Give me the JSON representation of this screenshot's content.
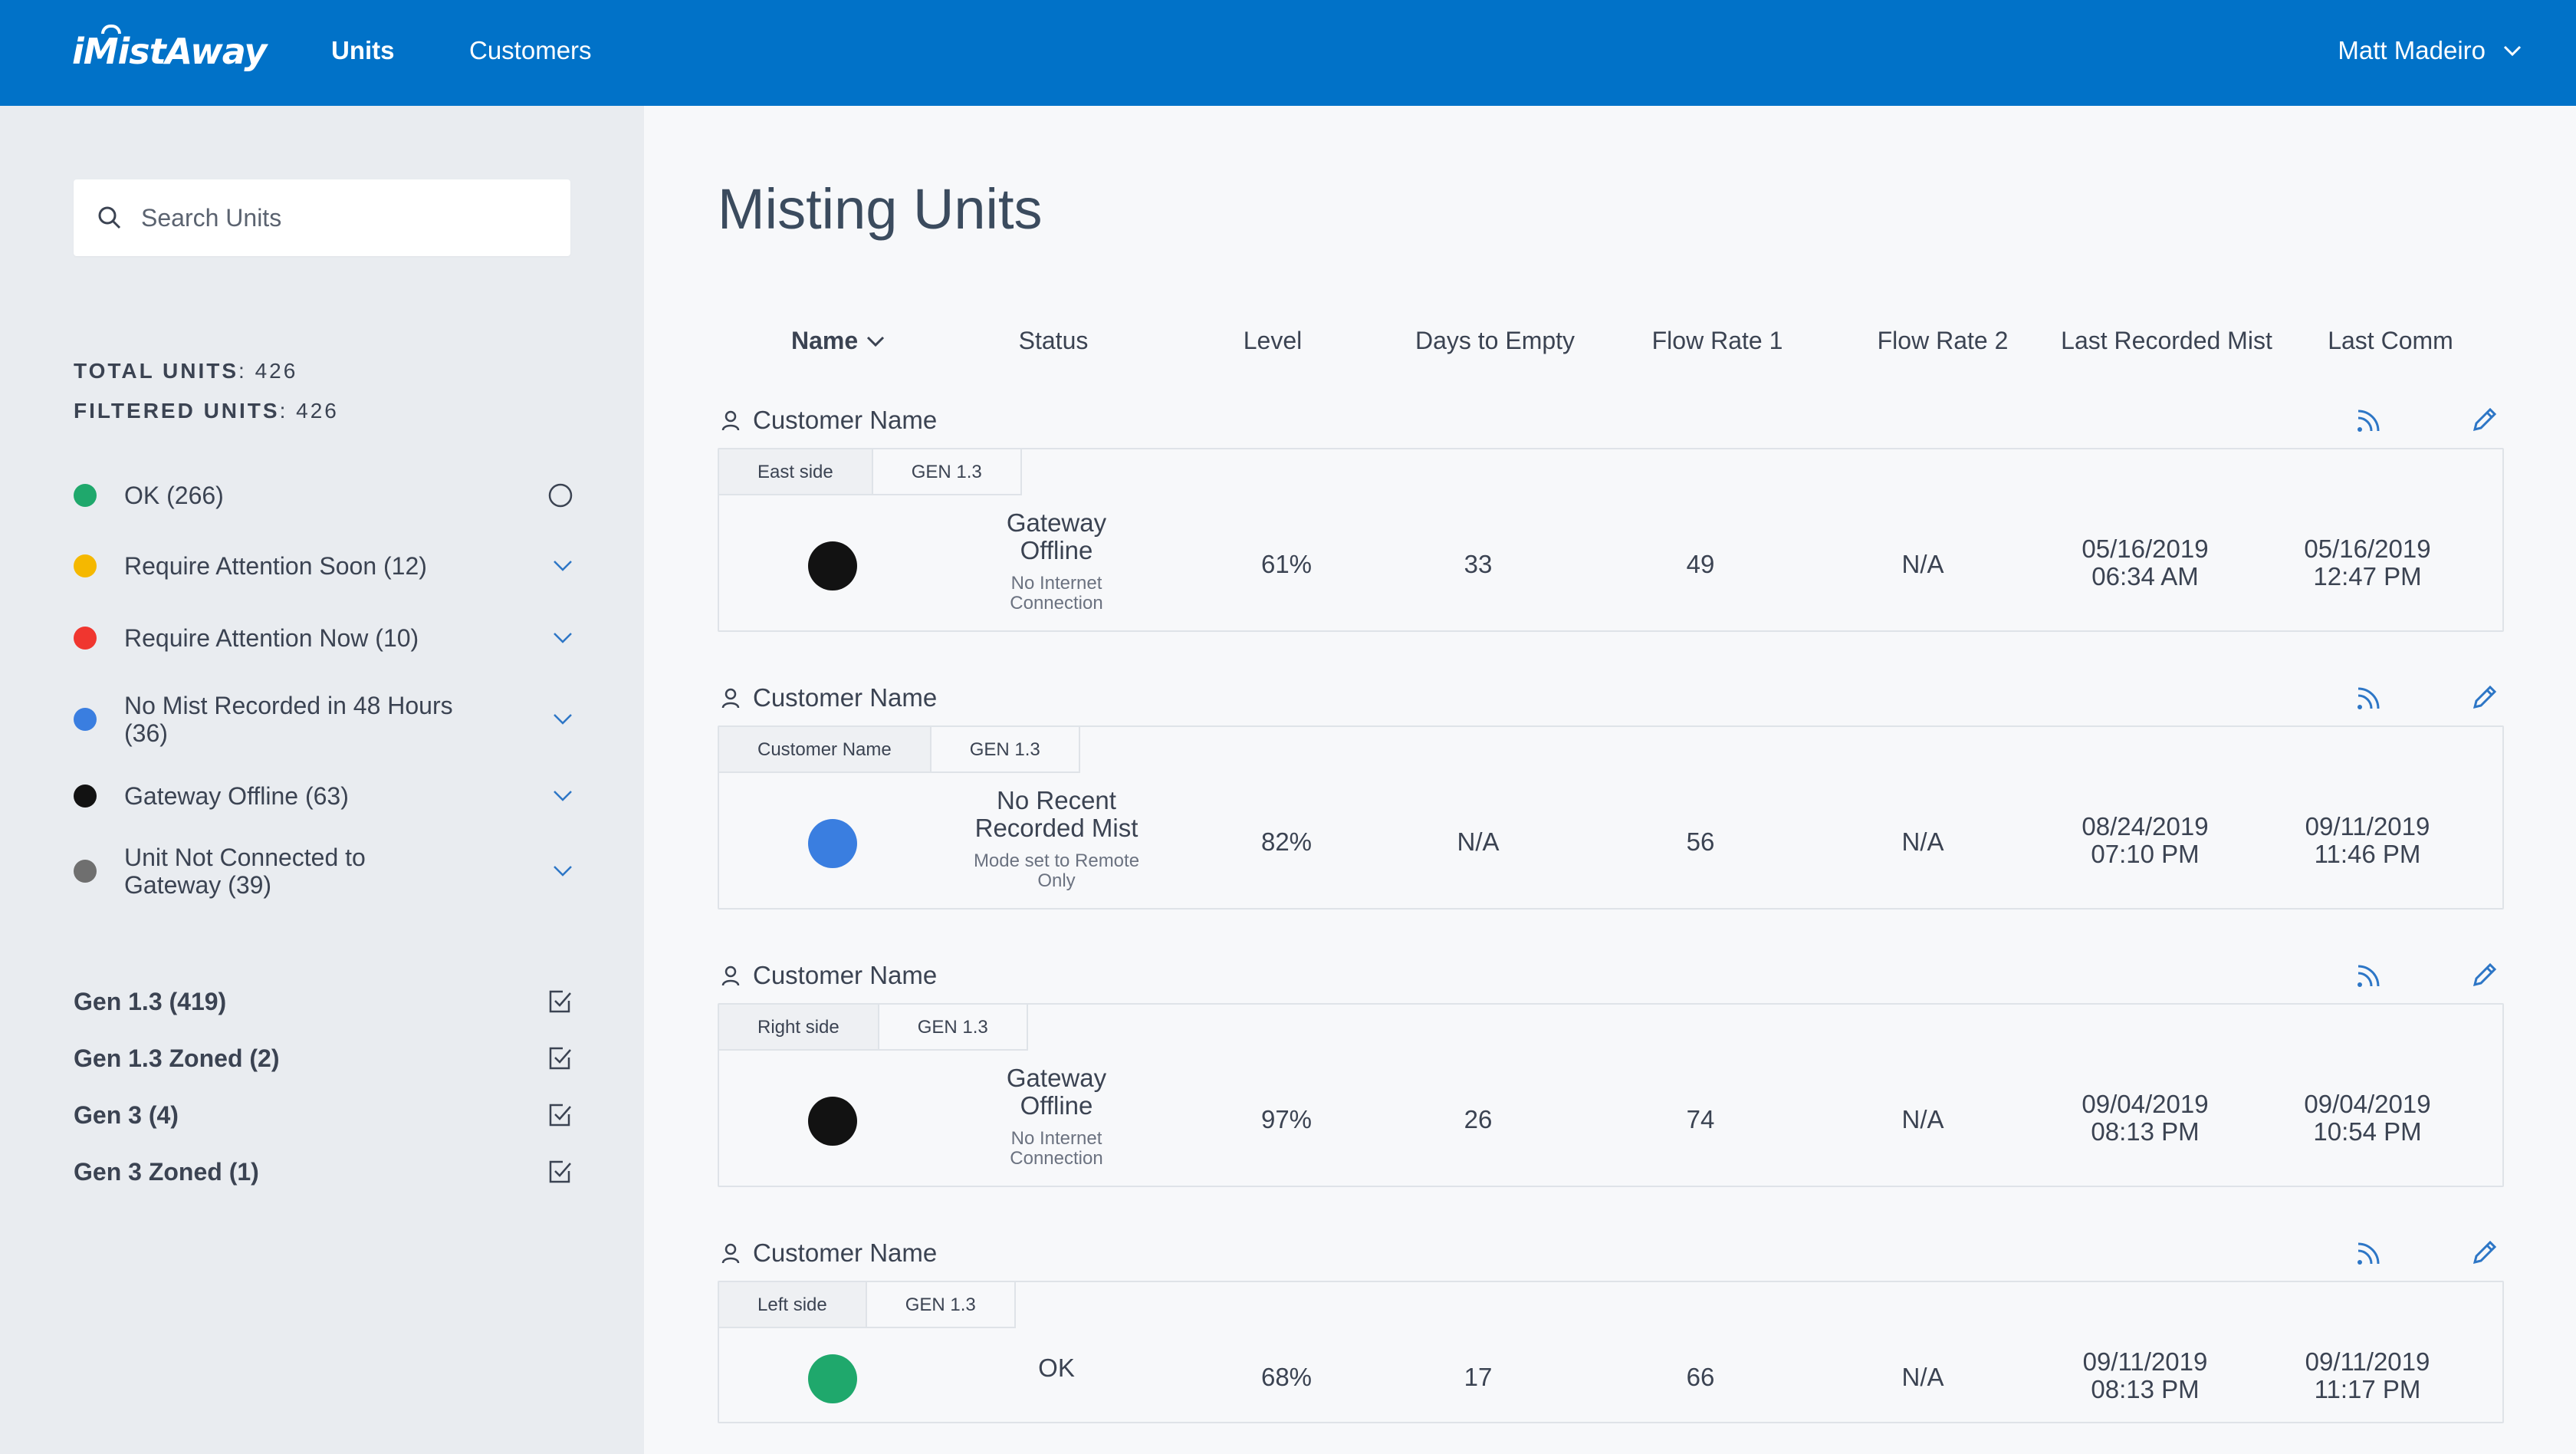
{
  "app": {
    "logo": "iMistAway"
  },
  "nav": {
    "units": "Units",
    "customers": "Customers"
  },
  "user": {
    "name": "Matt Madeiro"
  },
  "sidebar": {
    "search_placeholder": "Search Units",
    "total_label": "TOTAL UNITS",
    "total_value": "426",
    "filtered_label": "FILTERED UNITS",
    "filtered_value": "426",
    "statuses": [
      {
        "label": "OK (266)",
        "color": "#1fa86c",
        "control": "radio"
      },
      {
        "label": "Require Attention Soon (12)",
        "color": "#f5b800",
        "control": "chevron"
      },
      {
        "label": "Require Attention Now (10)",
        "color": "#f0362f",
        "control": "chevron"
      },
      {
        "label": "No Mist Recorded in 48 Hours (36)",
        "color": "#3a7ee0",
        "control": "chevron"
      },
      {
        "label": "Gateway Offline (63)",
        "color": "#121212",
        "control": "chevron"
      },
      {
        "label": "Unit Not Connected to Gateway (39)",
        "color": "#6f6f6f",
        "control": "chevron"
      }
    ],
    "gens": [
      {
        "label": "Gen 1.3 (419)",
        "checked": true
      },
      {
        "label": "Gen 1.3 Zoned (2)",
        "checked": true
      },
      {
        "label": "Gen 3 (4)",
        "checked": true
      },
      {
        "label": "Gen 3 Zoned (1)",
        "checked": true
      }
    ]
  },
  "main": {
    "title": "Misting Units",
    "columns": [
      "Name",
      "Status",
      "Level",
      "Days to Empty",
      "Flow Rate 1",
      "Flow Rate 2",
      "Last Recorded Mist",
      "Last Comm"
    ]
  },
  "units": [
    {
      "customer": "Customer Name",
      "tag1": "East side",
      "tag2": "GEN 1.3",
      "dot_color": "#121212",
      "status_main": "Gateway Offline",
      "status_sub": "No Internet Connection",
      "level": "61%",
      "days": "33",
      "flow1": "49",
      "flow2": "N/A",
      "mist_date": "05/16/2019",
      "mist_time": "06:34 AM",
      "comm_date": "05/16/2019",
      "comm_time": "12:47 PM"
    },
    {
      "customer": "Customer Name",
      "tag1": "Customer Name",
      "tag2": "GEN 1.3",
      "dot_color": "#3a7ee0",
      "status_main": "No Recent Recorded Mist",
      "status_sub": "Mode set to Remote Only",
      "level": "82%",
      "days": "N/A",
      "flow1": "56",
      "flow2": "N/A",
      "mist_date": "08/24/2019",
      "mist_time": "07:10 PM",
      "comm_date": "09/11/2019",
      "comm_time": "11:46 PM"
    },
    {
      "customer": "Customer Name",
      "tag1": "Right side",
      "tag2": "GEN 1.3",
      "dot_color": "#121212",
      "status_main": "Gateway Offline",
      "status_sub": "No Internet Connection",
      "level": "97%",
      "days": "26",
      "flow1": "74",
      "flow2": "N/A",
      "mist_date": "09/04/2019",
      "mist_time": "08:13 PM",
      "comm_date": "09/04/2019",
      "comm_time": "10:54 PM"
    },
    {
      "customer": "Customer Name",
      "tag1": "Left side",
      "tag2": "GEN 1.3",
      "dot_color": "#1fa86c",
      "status_main": "OK",
      "status_sub": "",
      "level": "68%",
      "days": "17",
      "flow1": "66",
      "flow2": "N/A",
      "mist_date": "09/11/2019",
      "mist_time": "08:13 PM",
      "comm_date": "09/11/2019",
      "comm_time": "11:17 PM"
    }
  ]
}
